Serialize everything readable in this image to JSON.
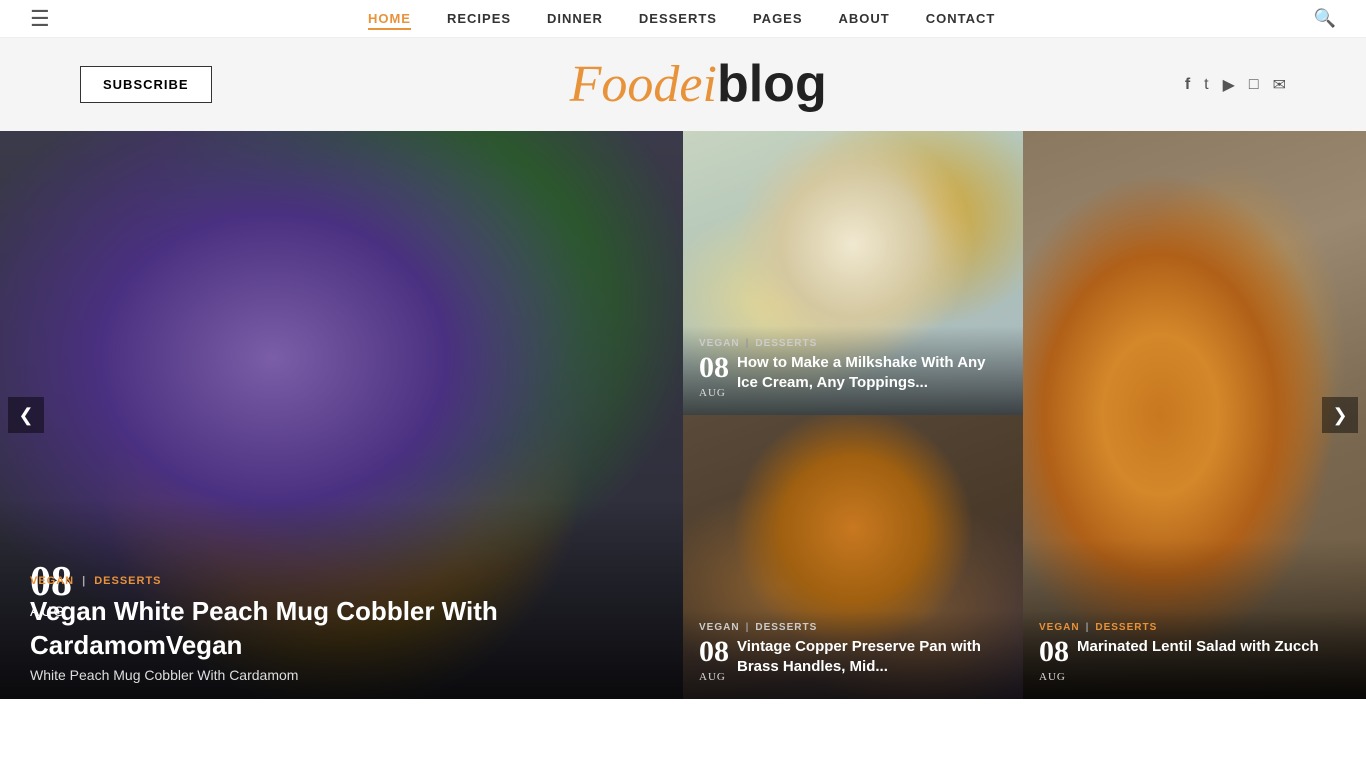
{
  "nav": {
    "menu_icon": "☰",
    "search_icon": "🔍",
    "links": [
      {
        "label": "HOME",
        "active": true
      },
      {
        "label": "RECIPES",
        "active": false
      },
      {
        "label": "DINNER",
        "active": false
      },
      {
        "label": "DESSERTS",
        "active": false
      },
      {
        "label": "PAGES",
        "active": false
      },
      {
        "label": "ABOUT",
        "active": false
      },
      {
        "label": "CONTACT",
        "active": false
      }
    ]
  },
  "header": {
    "subscribe_label": "SUBSCRIBE",
    "logo_foode": "Foode",
    "logo_i": "i",
    "logo_blog": "blog",
    "social": [
      {
        "name": "facebook-icon",
        "symbol": "f"
      },
      {
        "name": "twitter-icon",
        "symbol": "t"
      },
      {
        "name": "youtube-icon",
        "symbol": "▶"
      },
      {
        "name": "instagram-icon",
        "symbol": "◻"
      },
      {
        "name": "email-icon",
        "symbol": "✉"
      }
    ]
  },
  "slides": {
    "main": {
      "date_num": "08",
      "date_month": "AUG",
      "tag_vegan": "VEGAN",
      "tag_divider": "|",
      "tag_desserts": "DESSERTS",
      "title": "Vegan White Peach Mug Cobbler With CardamomVegan",
      "subtitle": "White Peach Mug Cobbler With Cardamom"
    },
    "top_right": {
      "date_num": "08",
      "date_month": "AUG",
      "tag_vegan": "VEGAN",
      "tag_divider": "|",
      "tag_desserts": "DESSERTS",
      "title": "How to Make a Milkshake With Any Ice Cream, Any Toppings..."
    },
    "bottom_right": {
      "date_num": "08",
      "date_month": "AUG",
      "tag_vegan": "VEGAN",
      "tag_divider": "|",
      "tag_desserts": "DESSERTS",
      "title": "Vintage Copper Preserve Pan with Brass Handles, Mid..."
    },
    "far_right": {
      "date_num": "08",
      "date_month": "AUG",
      "tag_vegan": "VEGAN",
      "tag_divider": "|",
      "tag_desserts": "DESSERTS",
      "title": "Marinated Lentil Salad with Zucch"
    }
  },
  "arrows": {
    "left": "❮",
    "right": "❯"
  }
}
